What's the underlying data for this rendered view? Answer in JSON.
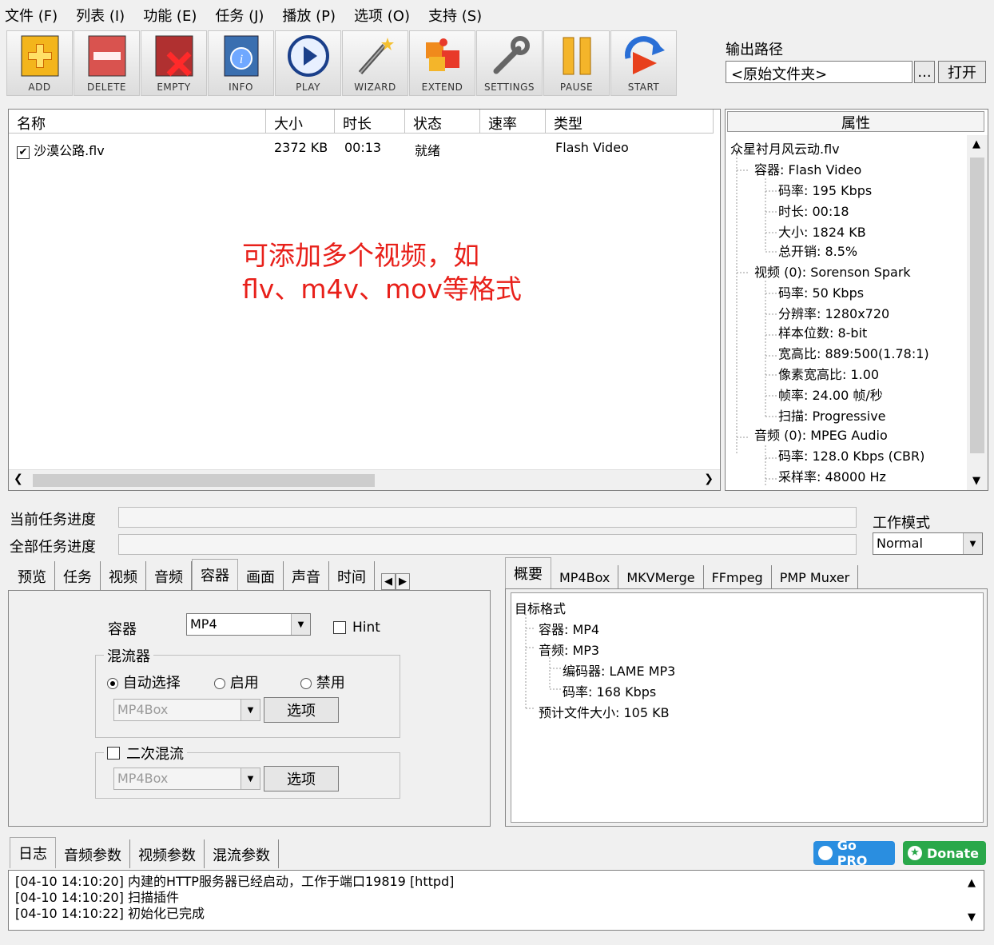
{
  "menu": [
    "文件 (F)",
    "列表 (I)",
    "功能 (E)",
    "任务 (J)",
    "播放 (P)",
    "选项 (O)",
    "支持 (S)"
  ],
  "toolbar": [
    {
      "label": "ADD",
      "icon": "add-icon"
    },
    {
      "label": "DELETE",
      "icon": "delete-icon"
    },
    {
      "label": "EMPTY",
      "icon": "empty-icon"
    },
    {
      "label": "INFO",
      "icon": "info-icon"
    },
    {
      "label": "PLAY",
      "icon": "play-icon"
    },
    {
      "label": "WIZARD",
      "icon": "wizard-icon"
    },
    {
      "label": "EXTEND",
      "icon": "extend-icon"
    },
    {
      "label": "SETTINGS",
      "icon": "settings-icon"
    },
    {
      "label": "PAUSE",
      "icon": "pause-icon"
    },
    {
      "label": "START",
      "icon": "start-icon"
    }
  ],
  "output": {
    "label": "输出路径",
    "value": "<原始文件夹>",
    "browse": "...",
    "open": "打开"
  },
  "filelist": {
    "columns": [
      "名称",
      "大小",
      "时长",
      "状态",
      "速率",
      "类型"
    ],
    "rows": [
      {
        "name": "沙漠公路.flv",
        "size": "2372 KB",
        "duration": "00:13",
        "status": "就绪",
        "rate": "",
        "type": "Flash Video",
        "checked": true
      }
    ],
    "annotation_line1": "可添加多个视频，如",
    "annotation_line2": "flv、m4v、mov等格式"
  },
  "properties": {
    "header": "属性",
    "tree": [
      "众星衬月风云动.flv",
      "容器: Flash Video",
      "码率: 195 Kbps",
      "时长: 00:18",
      "大小: 1824 KB",
      "总开销: 8.5%",
      "视频 (0): Sorenson Spark",
      "码率: 50 Kbps",
      "分辨率: 1280x720",
      "样本位数: 8-bit",
      "宽高比: 889:500(1.78:1)",
      "像素宽高比: 1.00",
      "帧率: 24.00 帧/秒",
      "扫描: Progressive",
      "音频 (0): MPEG Audio",
      "码率: 128.0 Kbps (CBR)",
      "采样率: 48000 Hz"
    ]
  },
  "progress": {
    "current_label": "当前任务进度",
    "total_label": "全部任务进度",
    "current": 0,
    "total": 0
  },
  "workmode": {
    "label": "工作模式",
    "value": "Normal"
  },
  "left_tabs": [
    "预览",
    "任务",
    "视频",
    "音频",
    "容器",
    "画面",
    "声音",
    "时间"
  ],
  "container_panel": {
    "container_label": "容器",
    "container_value": "MP4",
    "hint_label": "Hint",
    "muxer_group": "混流器",
    "radio_auto": "自动选择",
    "radio_enable": "启用",
    "radio_disable": "禁用",
    "muxer_value": "MP4Box",
    "options": "选项",
    "second_mux": "二次混流",
    "second_value": "MP4Box",
    "options2": "选项"
  },
  "right_tabs": [
    "概要",
    "MP4Box",
    "MKVMerge",
    "FFmpeg",
    "PMP Muxer"
  ],
  "summary_tree": [
    "目标格式",
    "容器: MP4",
    "音频: MP3",
    "编码器: LAME MP3",
    "码率: 168 Kbps",
    "预计文件大小: 105 KB"
  ],
  "bottom_tabs": [
    "日志",
    "音频参数",
    "视频参数",
    "混流参数"
  ],
  "gopro": "Go PRO",
  "donate": "Donate",
  "log": [
    "[04-10 14:10:20] 内建的HTTP服务器已经启动，工作于端口19819 [httpd]",
    "[04-10 14:10:20] 扫描插件",
    "[04-10 14:10:22] 初始化已完成"
  ]
}
